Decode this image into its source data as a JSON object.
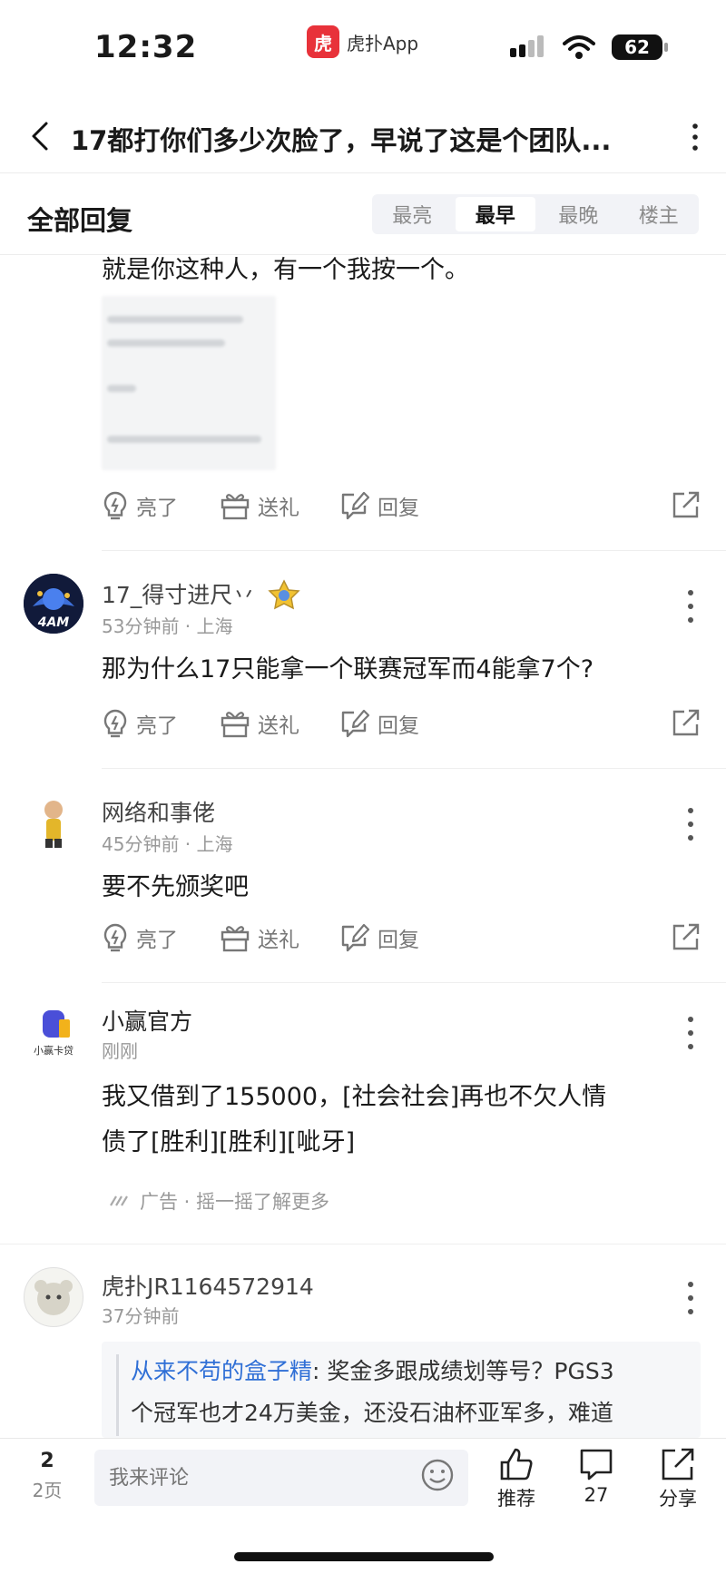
{
  "status": {
    "time": "12:32",
    "app_logo": "虎",
    "app_name": "虎扑App",
    "battery": "62"
  },
  "header": {
    "title": "17都打你们多少次脸了，早说了这是个团队..."
  },
  "replies": {
    "title": "全部回复",
    "sort_tabs": [
      "最亮",
      "最早",
      "最晚",
      "楼主"
    ],
    "active_tab": "最早"
  },
  "actions": {
    "like": "亮了",
    "gift": "送礼",
    "reply": "回复"
  },
  "comments": [
    {
      "text": "就是你这种人，有一个我按一个。"
    },
    {
      "user": "17_得寸进尺丷",
      "meta": "53分钟前 · 上海",
      "avatar_label": "4AM",
      "text": "那为什么17只能拿一个联赛冠军而4能拿7个?"
    },
    {
      "user": "网络和事佬",
      "meta": "45分钟前 · 上海",
      "text": "要不先颁奖吧"
    },
    {
      "user": "小赢官方",
      "meta": "刚刚",
      "avatar_label": "小赢卡贷",
      "text_line1": "我又借到了155000，[社会社会]再也不欠人情",
      "text_line2": "债了[胜利][胜利][呲牙]",
      "ad_label": "广告 · 摇一摇了解更多"
    },
    {
      "user": "虎扑JR1164572914",
      "meta": "37分钟前",
      "quote_author": "从来不苟的盒子精",
      "quote_text_line1": ": 奖金多跟成绩划等号？PGS3",
      "quote_text_line2": "个冠军也才24万美金，还没石油杯亚军多，难道"
    }
  ],
  "bottom_bar": {
    "page_current": "2",
    "page_label": "2页",
    "input_placeholder": "我来评论",
    "recommend_label": "推荐",
    "comment_count": "27",
    "share_label": "分享"
  }
}
